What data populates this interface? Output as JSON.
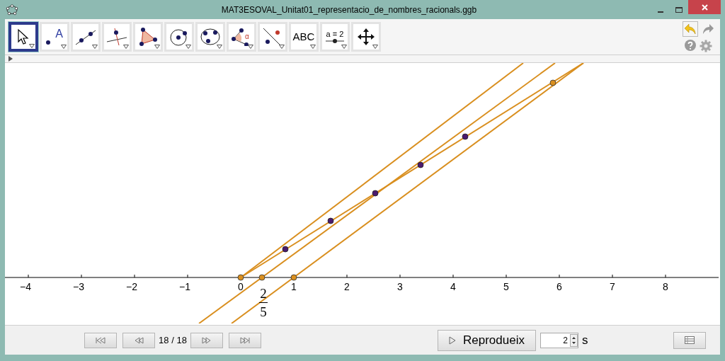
{
  "window": {
    "title": "MAT3ESOVAL_Unitat01_representacio_de_nombres_racionals.ggb"
  },
  "tools": [
    {
      "kind": "move",
      "selected": true
    },
    {
      "kind": "point",
      "text": "A",
      "selected": false
    },
    {
      "kind": "line",
      "selected": false
    },
    {
      "kind": "perpendicular",
      "selected": false
    },
    {
      "kind": "polygon",
      "selected": false
    },
    {
      "kind": "circle",
      "selected": false
    },
    {
      "kind": "conic",
      "selected": false
    },
    {
      "kind": "angle",
      "text": "α",
      "selected": false
    },
    {
      "kind": "reflect",
      "selected": false
    },
    {
      "kind": "text",
      "text": "ABC",
      "selected": false
    },
    {
      "kind": "slider",
      "text": "a = 2",
      "selected": false
    },
    {
      "kind": "pan",
      "selected": false
    }
  ],
  "undo": {
    "disabled": false
  },
  "redo": {
    "disabled": true
  },
  "axis_labels": [
    "−4",
    "−3",
    "−2",
    "−1",
    "0",
    "1",
    "2",
    "3",
    "4",
    "5",
    "6",
    "7",
    "8"
  ],
  "fraction": {
    "numerator": "2",
    "denominator": "5"
  },
  "navigation": {
    "counter": "18 / 18",
    "play_label": "Reprodueix",
    "speed": "2",
    "speed_unit": "s"
  }
}
